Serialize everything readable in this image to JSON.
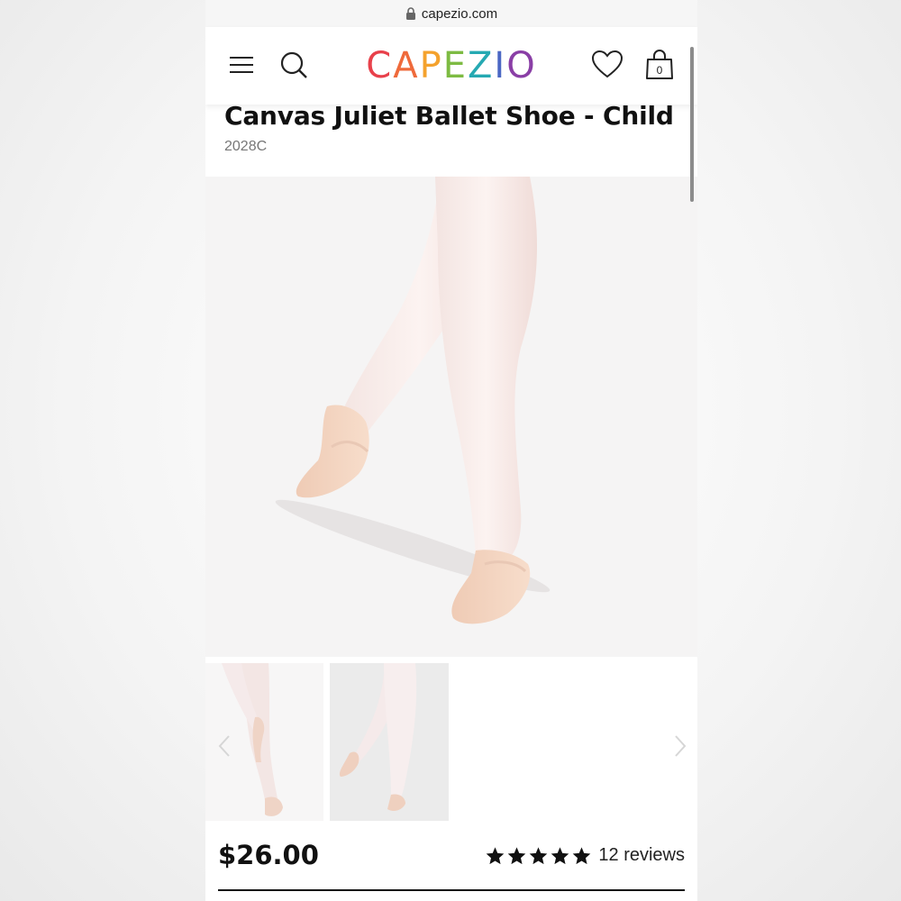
{
  "browser": {
    "url": "capezio.com"
  },
  "header": {
    "logo_letters": [
      {
        "char": "C",
        "color": "#e8414b"
      },
      {
        "char": "A",
        "color": "#ef6a3b"
      },
      {
        "char": "P",
        "color": "#f4a22d"
      },
      {
        "char": "E",
        "color": "#7dbb42"
      },
      {
        "char": "Z",
        "color": "#25a9b2"
      },
      {
        "char": "I",
        "color": "#4b67c4"
      },
      {
        "char": "O",
        "color": "#8a3fa6"
      }
    ],
    "cart_count": "0",
    "icons": [
      "menu-icon",
      "search-icon",
      "heart-icon",
      "shopping-bag-icon"
    ]
  },
  "product": {
    "title": "Canvas Juliet Ballet Shoe - Child",
    "sku": "2028C",
    "price": "$26.00",
    "rating": 5,
    "reviews_label": "12 reviews"
  },
  "gallery": {
    "thumbnail_count": 2,
    "nav_icons": [
      "chevron-left-icon",
      "chevron-right-icon"
    ]
  }
}
